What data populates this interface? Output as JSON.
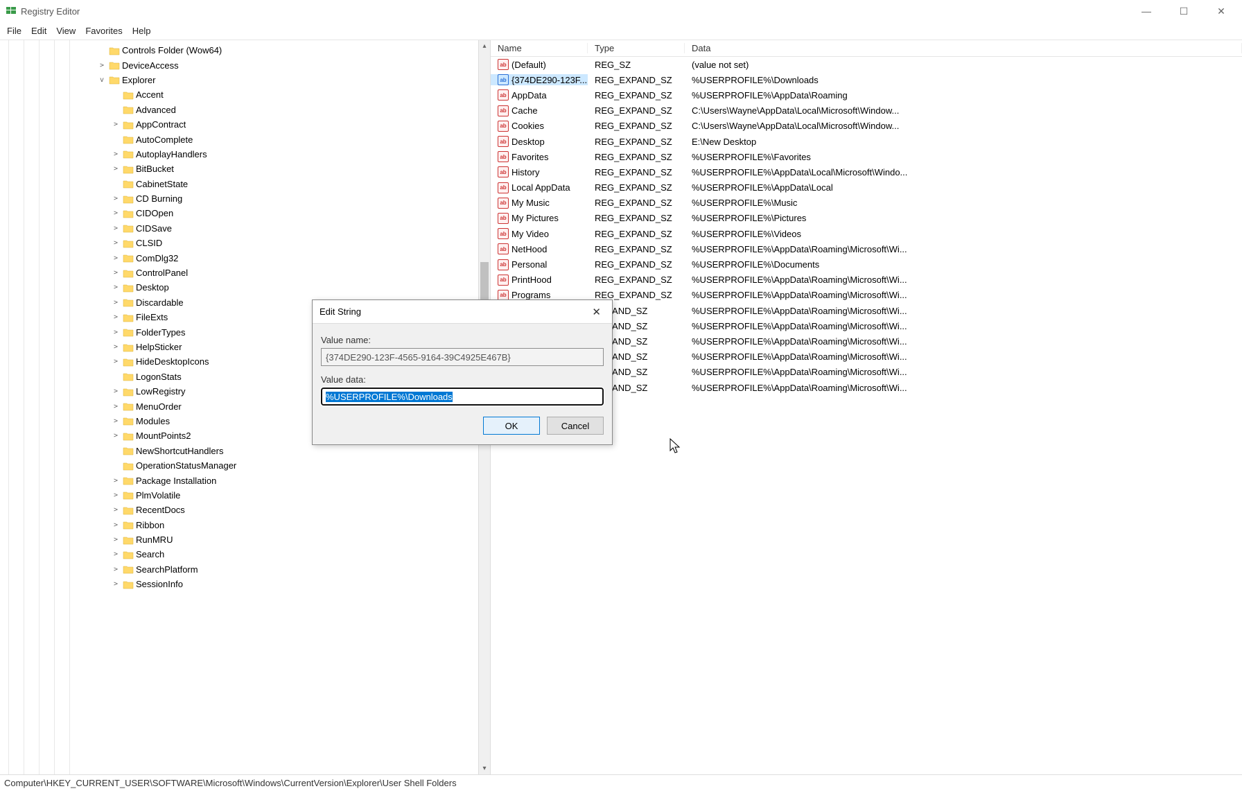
{
  "title": "Registry Editor",
  "menus": {
    "file": "File",
    "edit": "Edit",
    "view": "View",
    "favorites": "Favorites",
    "help": "Help"
  },
  "tree": [
    {
      "exp": "",
      "ind": 0,
      "label": "Controls Folder (Wow64)"
    },
    {
      "exp": ">",
      "ind": 0,
      "label": "DeviceAccess"
    },
    {
      "exp": "v",
      "ind": 0,
      "label": "Explorer"
    },
    {
      "exp": "",
      "ind": 1,
      "label": "Accent"
    },
    {
      "exp": "",
      "ind": 1,
      "label": "Advanced"
    },
    {
      "exp": ">",
      "ind": 1,
      "label": "AppContract"
    },
    {
      "exp": "",
      "ind": 1,
      "label": "AutoComplete"
    },
    {
      "exp": ">",
      "ind": 1,
      "label": "AutoplayHandlers"
    },
    {
      "exp": ">",
      "ind": 1,
      "label": "BitBucket"
    },
    {
      "exp": "",
      "ind": 1,
      "label": "CabinetState"
    },
    {
      "exp": ">",
      "ind": 1,
      "label": "CD Burning"
    },
    {
      "exp": ">",
      "ind": 1,
      "label": "CIDOpen"
    },
    {
      "exp": ">",
      "ind": 1,
      "label": "CIDSave"
    },
    {
      "exp": ">",
      "ind": 1,
      "label": "CLSID"
    },
    {
      "exp": ">",
      "ind": 1,
      "label": "ComDlg32"
    },
    {
      "exp": ">",
      "ind": 1,
      "label": "ControlPanel"
    },
    {
      "exp": ">",
      "ind": 1,
      "label": "Desktop"
    },
    {
      "exp": ">",
      "ind": 1,
      "label": "Discardable"
    },
    {
      "exp": ">",
      "ind": 1,
      "label": "FileExts"
    },
    {
      "exp": ">",
      "ind": 1,
      "label": "FolderTypes"
    },
    {
      "exp": ">",
      "ind": 1,
      "label": "HelpSticker"
    },
    {
      "exp": ">",
      "ind": 1,
      "label": "HideDesktopIcons"
    },
    {
      "exp": "",
      "ind": 1,
      "label": "LogonStats"
    },
    {
      "exp": ">",
      "ind": 1,
      "label": "LowRegistry"
    },
    {
      "exp": ">",
      "ind": 1,
      "label": "MenuOrder"
    },
    {
      "exp": ">",
      "ind": 1,
      "label": "Modules"
    },
    {
      "exp": ">",
      "ind": 1,
      "label": "MountPoints2"
    },
    {
      "exp": "",
      "ind": 1,
      "label": "NewShortcutHandlers"
    },
    {
      "exp": "",
      "ind": 1,
      "label": "OperationStatusManager"
    },
    {
      "exp": ">",
      "ind": 1,
      "label": "Package Installation"
    },
    {
      "exp": ">",
      "ind": 1,
      "label": "PlmVolatile"
    },
    {
      "exp": ">",
      "ind": 1,
      "label": "RecentDocs"
    },
    {
      "exp": ">",
      "ind": 1,
      "label": "Ribbon"
    },
    {
      "exp": ">",
      "ind": 1,
      "label": "RunMRU"
    },
    {
      "exp": ">",
      "ind": 1,
      "label": "Search"
    },
    {
      "exp": ">",
      "ind": 1,
      "label": "SearchPlatform"
    },
    {
      "exp": ">",
      "ind": 1,
      "label": "SessionInfo"
    }
  ],
  "columns": {
    "name": "Name",
    "type": "Type",
    "data": "Data"
  },
  "rows": [
    {
      "name": "(Default)",
      "type": "REG_SZ",
      "data": "(value not set)",
      "selected": false
    },
    {
      "name": "{374DE290-123F...",
      "type": "REG_EXPAND_SZ",
      "data": "%USERPROFILE%\\Downloads",
      "selected": true
    },
    {
      "name": "AppData",
      "type": "REG_EXPAND_SZ",
      "data": "%USERPROFILE%\\AppData\\Roaming",
      "selected": false
    },
    {
      "name": "Cache",
      "type": "REG_EXPAND_SZ",
      "data": "C:\\Users\\Wayne\\AppData\\Local\\Microsoft\\Window...",
      "selected": false
    },
    {
      "name": "Cookies",
      "type": "REG_EXPAND_SZ",
      "data": "C:\\Users\\Wayne\\AppData\\Local\\Microsoft\\Window...",
      "selected": false
    },
    {
      "name": "Desktop",
      "type": "REG_EXPAND_SZ",
      "data": "E:\\New Desktop",
      "selected": false
    },
    {
      "name": "Favorites",
      "type": "REG_EXPAND_SZ",
      "data": "%USERPROFILE%\\Favorites",
      "selected": false
    },
    {
      "name": "History",
      "type": "REG_EXPAND_SZ",
      "data": "%USERPROFILE%\\AppData\\Local\\Microsoft\\Windo...",
      "selected": false
    },
    {
      "name": "Local AppData",
      "type": "REG_EXPAND_SZ",
      "data": "%USERPROFILE%\\AppData\\Local",
      "selected": false
    },
    {
      "name": "My Music",
      "type": "REG_EXPAND_SZ",
      "data": "%USERPROFILE%\\Music",
      "selected": false
    },
    {
      "name": "My Pictures",
      "type": "REG_EXPAND_SZ",
      "data": "%USERPROFILE%\\Pictures",
      "selected": false
    },
    {
      "name": "My Video",
      "type": "REG_EXPAND_SZ",
      "data": "%USERPROFILE%\\Videos",
      "selected": false
    },
    {
      "name": "NetHood",
      "type": "REG_EXPAND_SZ",
      "data": "%USERPROFILE%\\AppData\\Roaming\\Microsoft\\Wi...",
      "selected": false
    },
    {
      "name": "Personal",
      "type": "REG_EXPAND_SZ",
      "data": "%USERPROFILE%\\Documents",
      "selected": false
    },
    {
      "name": "PrintHood",
      "type": "REG_EXPAND_SZ",
      "data": "%USERPROFILE%\\AppData\\Roaming\\Microsoft\\Wi...",
      "selected": false
    },
    {
      "name": "Programs",
      "type": "REG_EXPAND_SZ",
      "data": "%USERPROFILE%\\AppData\\Roaming\\Microsoft\\Wi...",
      "selected": false
    },
    {
      "name": "",
      "type": "EXPAND_SZ",
      "data": "%USERPROFILE%\\AppData\\Roaming\\Microsoft\\Wi...",
      "selected": false
    },
    {
      "name": "",
      "type": "EXPAND_SZ",
      "data": "%USERPROFILE%\\AppData\\Roaming\\Microsoft\\Wi...",
      "selected": false
    },
    {
      "name": "",
      "type": "EXPAND_SZ",
      "data": "%USERPROFILE%\\AppData\\Roaming\\Microsoft\\Wi...",
      "selected": false
    },
    {
      "name": "",
      "type": "EXPAND_SZ",
      "data": "%USERPROFILE%\\AppData\\Roaming\\Microsoft\\Wi...",
      "selected": false
    },
    {
      "name": "",
      "type": "EXPAND_SZ",
      "data": "%USERPROFILE%\\AppData\\Roaming\\Microsoft\\Wi...",
      "selected": false
    },
    {
      "name": "",
      "type": "EXPAND_SZ",
      "data": "%USERPROFILE%\\AppData\\Roaming\\Microsoft\\Wi...",
      "selected": false
    }
  ],
  "dialog": {
    "title": "Edit String",
    "label_name": "Value name:",
    "value_name": "{374DE290-123F-4565-9164-39C4925E467B}",
    "label_data": "Value data:",
    "value_data": "%USERPROFILE%\\Downloads",
    "ok": "OK",
    "cancel": "Cancel"
  },
  "statusbar": "Computer\\HKEY_CURRENT_USER\\SOFTWARE\\Microsoft\\Windows\\CurrentVersion\\Explorer\\User Shell Folders"
}
